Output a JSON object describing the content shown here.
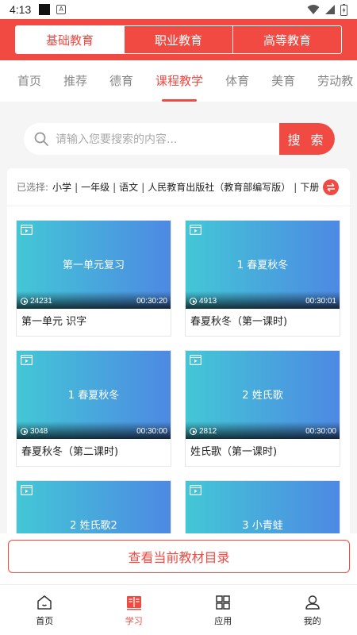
{
  "status_bar": {
    "time": "4:13",
    "a_badge": "A"
  },
  "segments": [
    {
      "label": "基础教育",
      "active": true
    },
    {
      "label": "职业教育",
      "active": false
    },
    {
      "label": "高等教育",
      "active": false
    }
  ],
  "categories": [
    {
      "label": "首页",
      "active": false
    },
    {
      "label": "推荐",
      "active": false
    },
    {
      "label": "德育",
      "active": false
    },
    {
      "label": "课程教学",
      "active": true
    },
    {
      "label": "体育",
      "active": false
    },
    {
      "label": "美育",
      "active": false
    },
    {
      "label": "劳动教",
      "active": false
    }
  ],
  "search": {
    "placeholder": "请输入您要搜索的内容...",
    "button_label": "搜 索"
  },
  "filter": {
    "label": "已选择:",
    "tags": [
      "小学",
      "一年级",
      "语文",
      "人民教育出版社（教育部编写版）",
      "下册"
    ]
  },
  "videos": [
    {
      "thumb_title": "第一单元复习",
      "views": "24231",
      "duration": "00:30:20",
      "caption": "第一单元 识字"
    },
    {
      "thumb_title": "1 春夏秋冬",
      "views": "4913",
      "duration": "00:30:01",
      "caption": "春夏秋冬（第一课时)"
    },
    {
      "thumb_title": "1 春夏秋冬",
      "views": "3048",
      "duration": "00:30:00",
      "caption": "春夏秋冬（第二课时)"
    },
    {
      "thumb_title": "2 姓氏歌",
      "views": "2812",
      "duration": "00:30:00",
      "caption": "姓氏歌（第一课时)"
    },
    {
      "thumb_title": "2 姓氏歌2",
      "views": "",
      "duration": "",
      "caption": ""
    },
    {
      "thumb_title": "3 小青蛙",
      "views": "",
      "duration": "",
      "caption": ""
    }
  ],
  "catalog_button": "查看当前教材目录",
  "tabbar": [
    {
      "label": "首页",
      "icon": "home-icon",
      "active": false
    },
    {
      "label": "学习",
      "icon": "book-icon",
      "active": true
    },
    {
      "label": "应用",
      "icon": "grid-apps-icon",
      "active": false
    },
    {
      "label": "我的",
      "icon": "user-icon",
      "active": false
    }
  ],
  "colors": {
    "accent": "#f04a42",
    "thumb_start": "#43c7d6",
    "thumb_end": "#4d89e3"
  }
}
